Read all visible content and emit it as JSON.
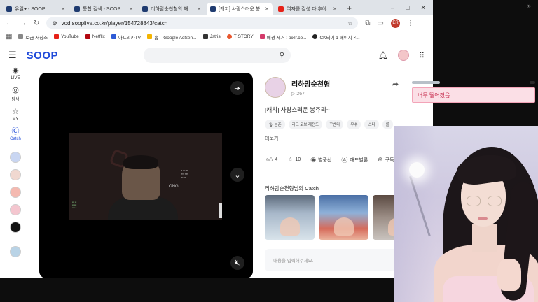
{
  "browser": {
    "tabs": [
      {
        "title": "유일♥ - SOOP",
        "favicon": "soop",
        "active": false
      },
      {
        "title": "통합 검색 - SOOP",
        "favicon": "soop",
        "active": false
      },
      {
        "title": "리하맘순천형의 채",
        "favicon": "soop",
        "active": false
      },
      {
        "title": "[캐치] 사랑스러운 봉",
        "favicon": "soop",
        "active": true
      },
      {
        "title": "여자를 감성 다 후야",
        "favicon": "youtube",
        "active": false
      }
    ],
    "new_tab": "+",
    "window_controls": [
      "–",
      "□",
      "✕"
    ],
    "url": "vod.sooplive.co.kr/player/154728843/catch",
    "profile_initials": "ER",
    "bookmarks": [
      "보금 저장소",
      "YouTube",
      "Netflix",
      "아프리카TV",
      "홈 – Google AdSen...",
      "Jstris",
      "TISTORY",
      "배경 제거 : pixlr.co...",
      "CK티어 1 페이지 ×..."
    ]
  },
  "soop": {
    "logo": "SOOP",
    "nav": [
      {
        "label": "LIVE",
        "icon": "live-icon",
        "glyph": "◉",
        "active": false
      },
      {
        "label": "탐색",
        "icon": "explore-icon",
        "glyph": "◎",
        "active": false
      },
      {
        "label": "MY",
        "icon": "star-icon",
        "glyph": "☆",
        "active": false
      },
      {
        "label": "Catch",
        "icon": "catch-icon",
        "glyph": "Ⓒ",
        "active": true
      }
    ],
    "accent": "#1f4ad9"
  },
  "player": {
    "stream_overlay_text": "ONG"
  },
  "info": {
    "channel_name": "리하맘순천형",
    "subscribers": "267",
    "video_title": "[캐치] 사랑스러운 봉쥬리~",
    "tags": [
      "봉준",
      "리그 오브 레전드",
      "꾸벤타",
      "우수",
      "스타",
      "롤"
    ],
    "more_label": "더보기",
    "actions": [
      {
        "label": "4",
        "icon": "thumbs-up-icon",
        "glyph": "👍︎"
      },
      {
        "label": "10",
        "icon": "star-icon",
        "glyph": "☆"
      },
      {
        "label": "별풍선",
        "icon": "balloon-icon",
        "glyph": "◉"
      },
      {
        "label": "애드벌룬",
        "icon": "adballoon-icon",
        "glyph": "Ⓐ"
      },
      {
        "label": "구독",
        "icon": "subscribe-icon",
        "glyph": "⊕"
      }
    ],
    "catch_section_title": "리하맘순천형님의 Catch",
    "comment_placeholder": "내용을 입력해주세요."
  },
  "overlay": {
    "tooltip_text": "너무 떨어졌음"
  }
}
